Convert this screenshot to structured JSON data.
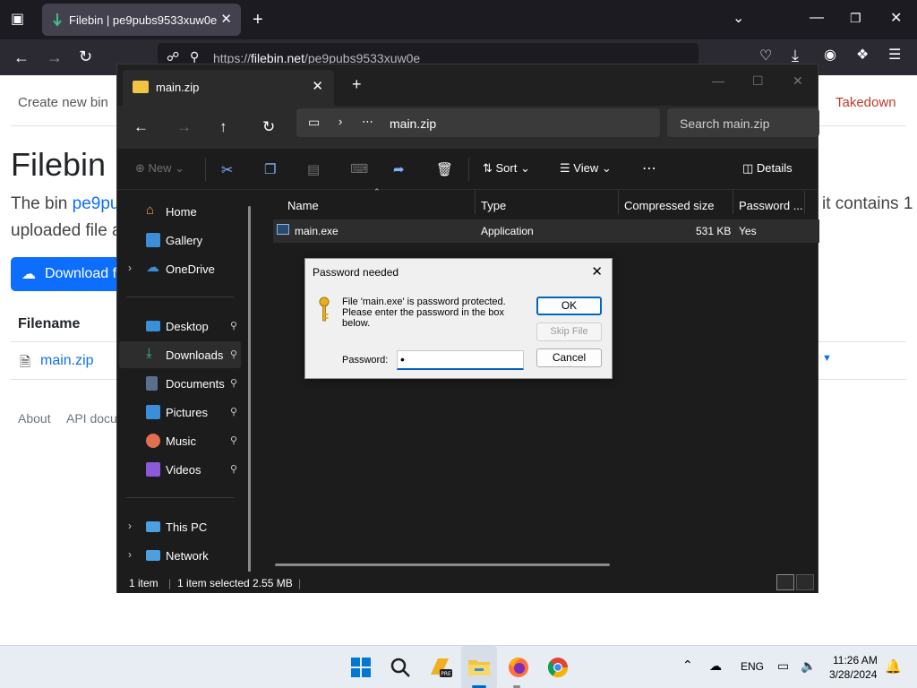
{
  "browser": {
    "tab_title": "Filebin | pe9pubs9533xuw0e",
    "url_prefix": "https://",
    "url_host": "filebin.net",
    "url_path": "/pe9pubs9533xuw0e"
  },
  "page": {
    "nav_create": "Create new bin",
    "nav_takedown": "Takedown",
    "heading": "Filebin",
    "desc_start": "The bin",
    "desc_link": "pe9pu",
    "desc_right": "it contains 1",
    "desc_line2": "uploaded file a",
    "download_label": "Download f",
    "filename_header": "Filename",
    "file_link": "main.zip",
    "footer_about": "About",
    "footer_api": "API docu"
  },
  "explorer": {
    "tab_title": "main.zip",
    "address_label": "main.zip",
    "search_placeholder": "Search main.zip",
    "cmd_new": "New",
    "cmd_sort": "Sort",
    "cmd_view": "View",
    "cmd_details": "Details",
    "nav": {
      "home": "Home",
      "gallery": "Gallery",
      "onedrive": "OneDrive",
      "desktop": "Desktop",
      "downloads": "Downloads",
      "documents": "Documents",
      "pictures": "Pictures",
      "music": "Music",
      "videos": "Videos",
      "thispc": "This PC",
      "network": "Network"
    },
    "columns": {
      "name": "Name",
      "type": "Type",
      "compressed": "Compressed size",
      "password": "Password ..."
    },
    "file": {
      "name": "main.exe",
      "type": "Application",
      "size": "531 KB",
      "password": "Yes"
    },
    "status": {
      "count": "1 item",
      "selected": "1 item selected  2.55 MB"
    }
  },
  "dialog": {
    "title": "Password needed",
    "message": "File 'main.exe' is password protected. Please enter the password in the box below.",
    "password_label": "Password:",
    "password_value": "•",
    "ok": "OK",
    "skip": "Skip File",
    "cancel": "Cancel"
  },
  "taskbar": {
    "lang": "ENG",
    "time": "11:26 AM",
    "date": "3/28/2024"
  }
}
